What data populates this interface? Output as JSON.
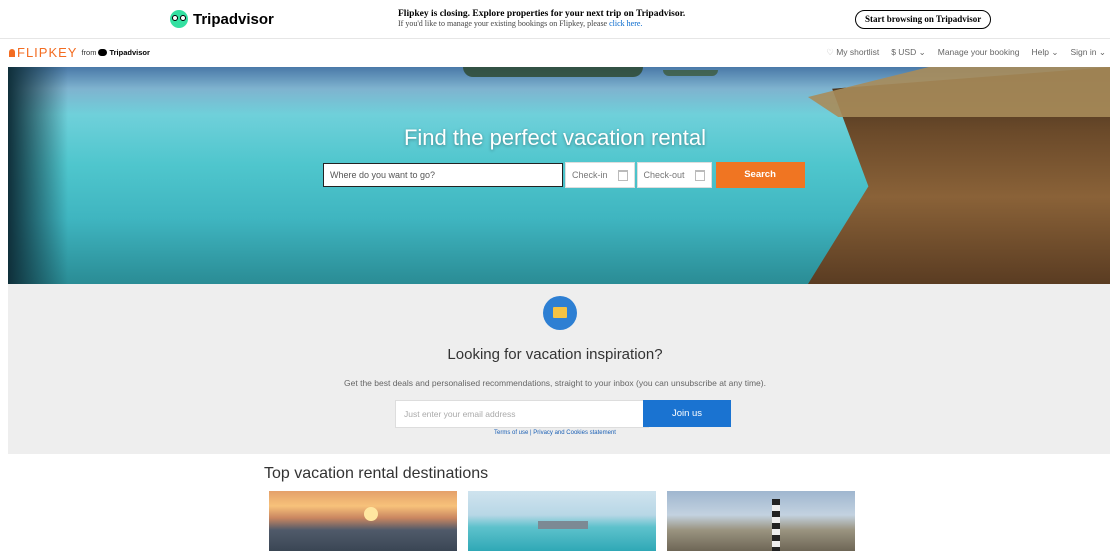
{
  "banner": {
    "logo_text": "Tripadvisor",
    "headline": "Flipkey is closing. Explore properties for your next trip on Tripadvisor.",
    "subline": "If you'd like to manage your existing bookings on Flipkey, please",
    "link": "click here.",
    "cta": "Start browsing on Tripadvisor"
  },
  "header": {
    "logo_text": "FLIPKEY",
    "from_text": "from",
    "from_brand": "Tripadvisor",
    "nav": [
      "My shortlist",
      "$ USD",
      "Manage your booking",
      "Help",
      "Sign in"
    ]
  },
  "hero": {
    "title": "Find the perfect vacation rental",
    "where_placeholder": "Where do you want to go?",
    "checkin_label": "Check-in",
    "checkout_label": "Check-out",
    "search_label": "Search"
  },
  "newsletter": {
    "title": "Looking for vacation inspiration?",
    "subtitle": "Get the best deals and personalised recommendations, straight to your inbox (you can unsubscribe at any time).",
    "email_placeholder": "Just enter your email address",
    "join_label": "Join us",
    "terms_text": "Terms of use | Privacy and Cookies statement"
  },
  "destinations": {
    "title": "Top vacation rental destinations"
  },
  "colors": {
    "brand_orange": "#f36c21",
    "search_orange": "#f07522",
    "join_blue": "#1a73d1",
    "ta_green": "#34e0a1"
  }
}
